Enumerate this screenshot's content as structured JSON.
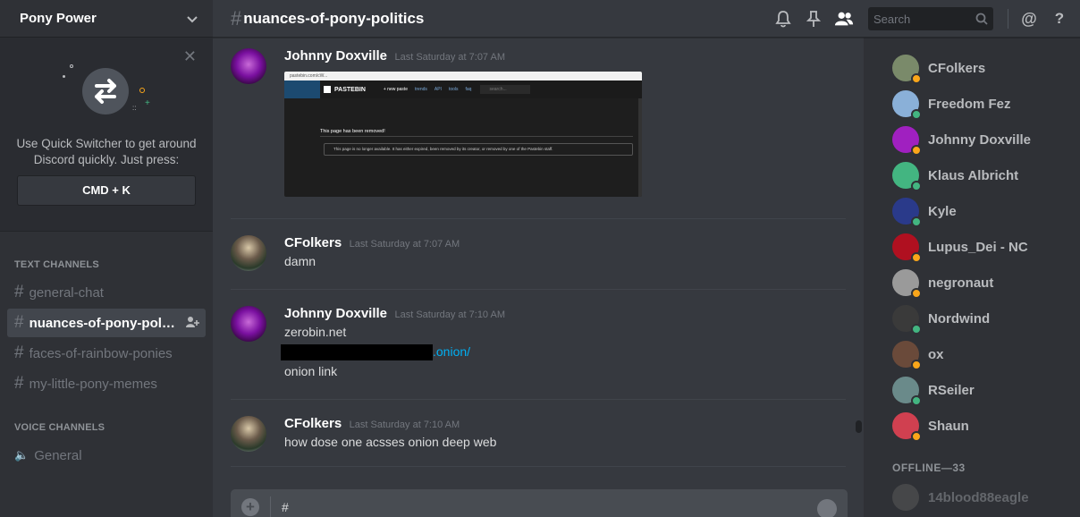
{
  "guild": {
    "name": "Pony Power"
  },
  "switcher": {
    "tip": "Use Quick Switcher to get around Discord quickly. Just press:",
    "shortcut": "CMD + K"
  },
  "sidebar": {
    "text_category": "TEXT CHANNELS",
    "text_channels": [
      {
        "name": "general-chat",
        "active": false
      },
      {
        "name": "nuances-of-pony-politics",
        "active": true
      },
      {
        "name": "faces-of-rainbow-ponies",
        "active": false
      },
      {
        "name": "my-little-pony-memes",
        "active": false
      }
    ],
    "voice_category": "VOICE CHANNELS",
    "voice_channels": [
      {
        "name": "General"
      }
    ]
  },
  "header": {
    "channel_name": "nuances-of-pony-politics",
    "search_placeholder": "Search"
  },
  "messages": [
    {
      "author": "Johnny Doxville",
      "timestamp": "Last Saturday at 7:07 AM",
      "embed": {
        "url_text": "pastebin.com/cW...",
        "brand": "PASTEBIN",
        "nav": [
          "+ new paste",
          "trends",
          "API",
          "tools",
          "faq"
        ],
        "search": "search...",
        "removed_title": "This page has been removed!",
        "removed_text": "This page is no longer available. It has either expired, been removed by its creator, or removed by one of the Pastebin staff."
      }
    },
    {
      "author": "CFolkers",
      "timestamp": "Last Saturday at 7:07 AM",
      "lines": [
        "damn"
      ]
    },
    {
      "author": "Johnny Doxville",
      "timestamp": "Last Saturday at 7:10 AM",
      "lines": [
        "zerobin.net"
      ],
      "link": ".onion/",
      "after": "onion link"
    },
    {
      "author": "CFolkers",
      "timestamp": "Last Saturday at 7:10 AM",
      "lines": [
        "how dose one acsses onion deep web"
      ]
    }
  ],
  "composer": {
    "text": "#"
  },
  "members": {
    "online": [
      {
        "name": "CFolkers",
        "status": "idle",
        "color": "#7a8a6a"
      },
      {
        "name": "Freedom Fez",
        "status": "online",
        "color": "#8ab0d8"
      },
      {
        "name": "Johnny Doxville",
        "status": "idle",
        "color": "#a020c0"
      },
      {
        "name": "Klaus Albricht",
        "status": "online",
        "color": "#43b581"
      },
      {
        "name": "Kyle",
        "status": "online",
        "color": "#2a3a8a"
      },
      {
        "name": "Lupus_Dei - NC",
        "status": "idle",
        "color": "#b01020"
      },
      {
        "name": "negronaut",
        "status": "idle",
        "color": "#9a9a9a"
      },
      {
        "name": "Nordwind",
        "status": "online",
        "color": "#3a3a3a"
      },
      {
        "name": "ox",
        "status": "idle",
        "color": "#6a4a3a"
      },
      {
        "name": "RSeiler",
        "status": "online",
        "color": "#6a8a8a"
      },
      {
        "name": "Shaun",
        "status": "idle",
        "color": "#d04050"
      }
    ],
    "offline_label": "OFFLINE—33",
    "offline": [
      {
        "name": "14blood88eagle",
        "color": "#5a5a5a"
      }
    ]
  }
}
